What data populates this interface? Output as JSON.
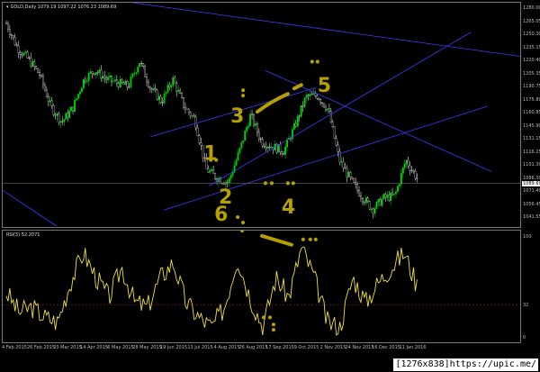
{
  "header": {
    "title": "GOLD,Daily  1079.19 1097.22 1076.23 1089.69"
  },
  "rsi": {
    "title": "RSI(5) 52.2071",
    "level_label": "32"
  },
  "price_axis": {
    "labels": [
      "1280.00",
      "1265.05",
      "1250.30",
      "1235.15",
      "1220.40",
      "1205.35",
      "1190.75",
      "1175.80",
      "1160.85",
      "1145.90",
      "1131.15",
      "1116.25",
      "1101.30",
      "1086.30",
      "1071.40",
      "1056.45",
      "1041.55"
    ],
    "current": "1089.69"
  },
  "rsi_axis": {
    "labels": [
      "100",
      "32",
      "0"
    ]
  },
  "time_axis": {
    "labels": [
      "4 Feb 2015",
      "26 Feb 2015",
      "20 Mar 2015",
      "14 Apr 2015",
      "6 May 2015",
      "28 May 2015",
      "19 Jun 2015",
      "13 Jul 2015",
      "4 Aug 2015",
      "26 Aug 2015",
      "17 Sep 2015",
      "9 Oct 2015",
      "2 Nov 2015",
      "24 Nov 2015",
      "16 Dec 2015",
      "11 Jan 2016"
    ]
  },
  "watermark": {
    "size": "[1276x838]",
    "site": "https://upic.me/"
  },
  "annotations": {
    "labels": [
      "1",
      "2",
      "3",
      "4",
      "5",
      "6"
    ]
  },
  "colors": {
    "bull": "#00d400",
    "bear": "#ffffff",
    "rsi_line": "#f0e040",
    "trend_lines": "#3c3cff",
    "annotation": "#b4a000"
  },
  "chart_data": [
    {
      "type": "candlestick",
      "title": "GOLD,Daily",
      "price_scale": {
        "min": 1041.55,
        "max": 1280.0
      },
      "close_trace": [
        [
          "4 Feb 2015",
          1262
        ],
        [
          "2015-02-10",
          1235
        ],
        [
          "2015-02-16",
          1222
        ],
        [
          "26 Feb 2015",
          1205
        ],
        [
          "2015-03-06",
          1170
        ],
        [
          "2015-03-12",
          1152
        ],
        [
          "20 Mar 2015",
          1168
        ],
        [
          "2015-03-27",
          1200
        ],
        [
          "2015-04-06",
          1210
        ],
        [
          "14 Apr 2015",
          1200
        ],
        [
          "2015-04-22",
          1196
        ],
        [
          "6 May 2015",
          1192
        ],
        [
          "2015-05-14",
          1220
        ],
        [
          "28 May 2015",
          1190
        ],
        [
          "2015-06-08",
          1175
        ],
        [
          "19 Jun 2015",
          1200
        ],
        [
          "2015-06-30",
          1170
        ],
        [
          "13 Jul 2015",
          1155
        ],
        [
          "2015-07-20",
          1100
        ],
        [
          "2015-07-27",
          1090
        ],
        [
          "4 Aug 2015",
          1085
        ],
        [
          "2015-08-12",
          1120
        ],
        [
          "2015-08-21",
          1160
        ],
        [
          "26 Aug 2015",
          1130
        ],
        [
          "2015-09-03",
          1125
        ],
        [
          "17 Sep 2015",
          1120
        ],
        [
          "2015-09-25",
          1148
        ],
        [
          "9 Oct 2015",
          1180
        ],
        [
          "2015-10-15",
          1182
        ],
        [
          "2015-10-22",
          1166
        ],
        [
          "2 Nov 2015",
          1110
        ],
        [
          "2015-11-10",
          1088
        ],
        [
          "24 Nov 2015",
          1070
        ],
        [
          "2015-12-03",
          1055
        ],
        [
          "16 Dec 2015",
          1068
        ],
        [
          "2015-12-24",
          1070
        ],
        [
          "2016-01-05",
          1110
        ],
        [
          "11 Jan 2016",
          1089.69
        ]
      ],
      "last": {
        "open": 1079.19,
        "high": 1097.22,
        "low": 1076.23,
        "close": 1089.69
      }
    },
    {
      "type": "line",
      "title": "RSI(5) 52.2071",
      "ylim": [
        0,
        100
      ],
      "level": 32,
      "x": [
        "4 Feb 2015",
        "2015-02-12",
        "26 Feb 2015",
        "2015-03-06",
        "2015-03-12",
        "20 Mar 2015",
        "2015-03-28",
        "14 Apr 2015",
        "2015-04-24",
        "6 May 2015",
        "2015-05-16",
        "28 May 2015",
        "2015-06-06",
        "19 Jun 2015",
        "2015-06-30",
        "13 Jul 2015",
        "2015-07-20",
        "4 Aug 2015",
        "2015-08-14",
        "26 Aug 2015",
        "2015-09-06",
        "17 Sep 2015",
        "2015-09-28",
        "9 Oct 2015",
        "2015-10-18",
        "2 Nov 2015",
        "2015-11-12",
        "24 Nov 2015",
        "2015-12-06",
        "16 Dec 2015",
        "2015-12-28",
        "2016-01-04",
        "11 Jan 2016"
      ],
      "values": [
        45,
        25,
        30,
        20,
        15,
        55,
        85,
        60,
        40,
        70,
        35,
        30,
        60,
        75,
        35,
        20,
        10,
        30,
        80,
        40,
        10,
        60,
        40,
        90,
        60,
        15,
        10,
        60,
        35,
        55,
        70,
        85,
        52.2
      ]
    }
  ]
}
